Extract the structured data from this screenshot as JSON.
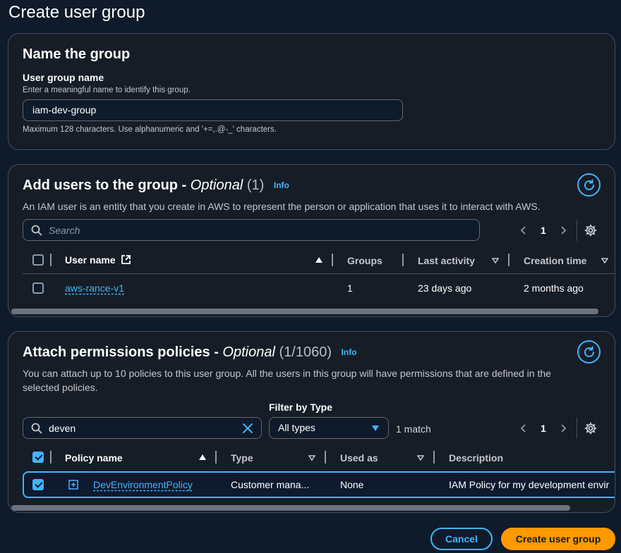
{
  "page": {
    "title": "Create user group"
  },
  "name_section": {
    "title": "Name the group",
    "field_label": "User group name",
    "field_description": "Enter a meaningful name to identify this group.",
    "field_value": "iam-dev-group",
    "constraint_hint": "Maximum 128 characters. Use alphanumeric and '+=,.@-_' characters."
  },
  "users_section": {
    "title": "Add users to the group - ",
    "title_optional": "Optional",
    "count": "(1)",
    "info": "Info",
    "description": "An IAM user is an entity that you create in AWS to represent the person or application that uses it to interact with AWS.",
    "search_placeholder": "Search",
    "page_number": "1",
    "columns": [
      "User name",
      "Groups",
      "Last activity",
      "Creation time"
    ],
    "rows": [
      {
        "user_name": "aws-rance-v1",
        "groups": "1",
        "last_activity": "23 days ago",
        "creation_time": "2 months ago",
        "selected": false
      }
    ]
  },
  "policies_section": {
    "title": "Attach permissions policies - ",
    "title_optional": "Optional",
    "count": "(1/1060)",
    "info": "Info",
    "description_line1": "You can attach up to 10 policies to this user group. All the users in this group will have permissions that are defined in the",
    "description_line2": "selected policies.",
    "filter_label": "Filter by Type",
    "search_value": "deven",
    "type_filter_value": "All types",
    "match_text": "1 match",
    "page_number": "1",
    "columns": [
      "Policy name",
      "Type",
      "Used as",
      "Description"
    ],
    "rows": [
      {
        "policy_name": "DevEnvironmentPolicy",
        "type": "Customer mana...",
        "used_as": "None",
        "description": "IAM Policy for my development envir",
        "selected": true
      }
    ]
  },
  "footer": {
    "cancel_label": "Cancel",
    "create_label": "Create user group"
  },
  "colors": {
    "background": "#0f1b2a",
    "panel": "#161d26",
    "accent_blue": "#42b4ff",
    "primary_orange": "#ff9900"
  },
  "icons": [
    "search-icon",
    "external-link-icon",
    "refresh-icon",
    "gear-icon",
    "chevron-left-icon",
    "chevron-right-icon",
    "sort-ascending-icon",
    "sort-descending-icon",
    "clear-icon",
    "expand-icon",
    "caret-down-icon"
  ]
}
